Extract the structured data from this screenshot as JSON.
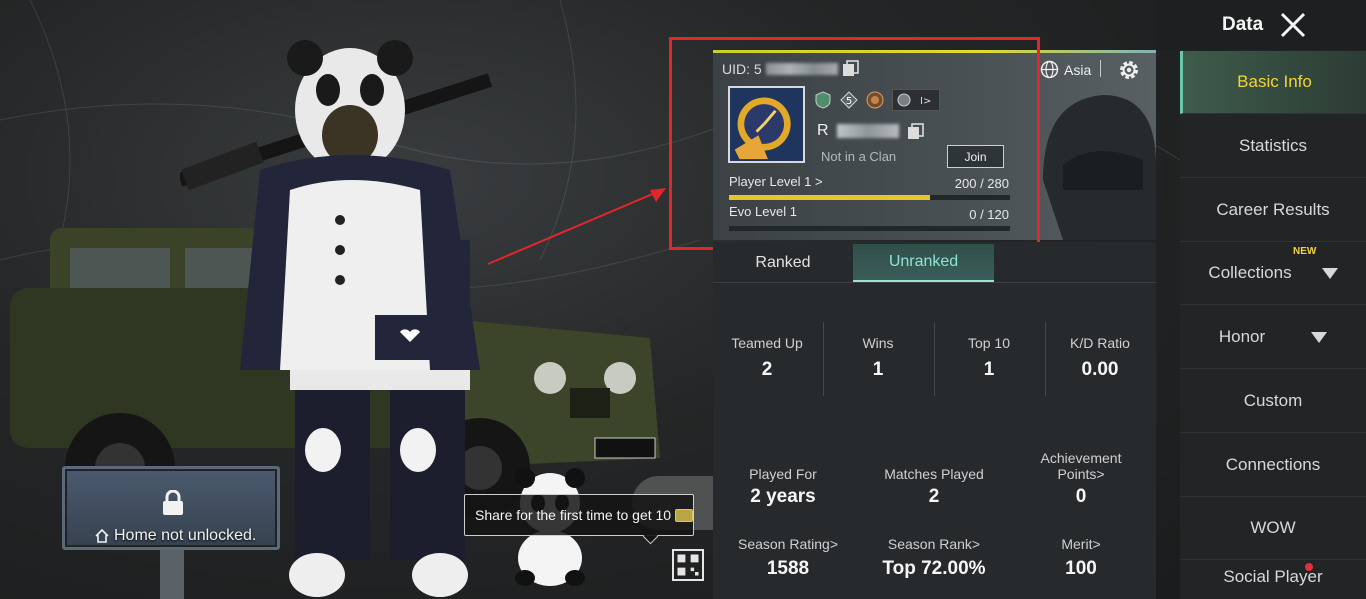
{
  "header": {
    "title": "Data",
    "close_icon": "close-icon"
  },
  "player_card": {
    "uid_label": "UID: 5",
    "region": "Asia",
    "player_name_initial": "R",
    "clan_status": "Not in a Clan",
    "join_label": "Join",
    "player_level_label": "Player Level",
    "player_level_value": "1 >",
    "player_level_progress": "200 / 280",
    "player_level_fraction": 0.714,
    "evo_level_label": "Evo Level",
    "evo_level_value": "1",
    "evo_level_progress": "0 / 120",
    "evo_level_fraction": 0
  },
  "tabs": [
    {
      "label": "Ranked",
      "active": false
    },
    {
      "label": "Unranked",
      "active": true
    }
  ],
  "stats_row1": [
    {
      "label": "Teamed Up",
      "value": "2"
    },
    {
      "label": "Wins",
      "value": "1"
    },
    {
      "label": "Top 10",
      "value": "1"
    },
    {
      "label": "K/D Ratio",
      "value": "0.00"
    }
  ],
  "stats_row2": [
    {
      "label": "Played For",
      "value": "2 years"
    },
    {
      "label": "Matches Played",
      "value": "2"
    },
    {
      "label": "Achievement Points>",
      "value": "0"
    }
  ],
  "stats_row3": [
    {
      "label": "Season Rating>",
      "value": "1588"
    },
    {
      "label": "Season Rank>",
      "value": "Top 72.00%"
    },
    {
      "label": "Merit>",
      "value": "100"
    }
  ],
  "sidebar": {
    "items": [
      {
        "label": "Basic Info",
        "active": true
      },
      {
        "label": "Statistics"
      },
      {
        "label": "Career Results"
      },
      {
        "label": "Collections",
        "badge": "NEW"
      },
      {
        "label": "Honor"
      },
      {
        "label": "Custom"
      },
      {
        "label": "Connections"
      },
      {
        "label": "WOW"
      },
      {
        "label": "Social Player"
      }
    ]
  },
  "scene": {
    "home_status": "Home not unlocked.",
    "share_tip": "Share for the first time to get 10"
  },
  "colors": {
    "accent_yellow": "#f2d436",
    "accent_teal": "#8ee4d3",
    "annotation_red": "#e3262a",
    "progress_yellow": "#e6c52b"
  }
}
